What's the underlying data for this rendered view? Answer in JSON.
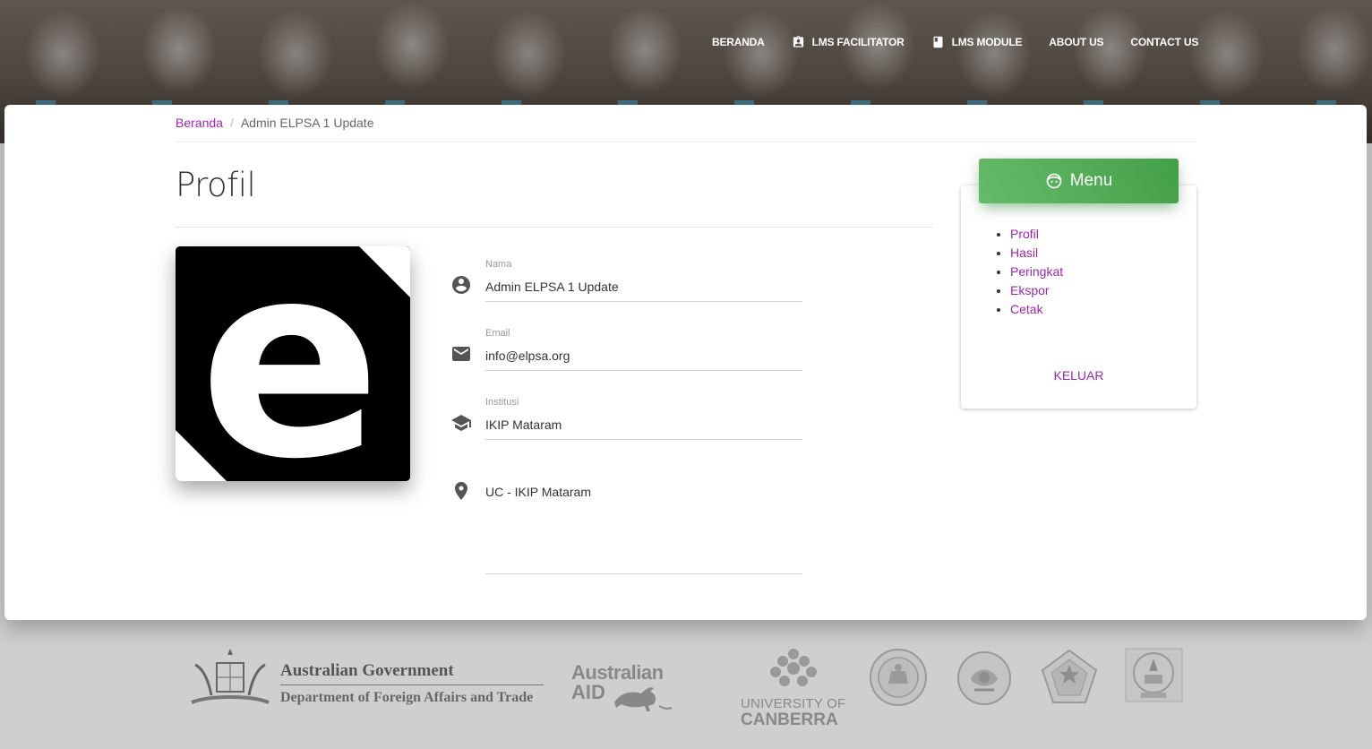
{
  "nav": {
    "items": [
      {
        "label": "BERANDA",
        "icon": ""
      },
      {
        "label": "LMS FACILITATOR",
        "icon": "assignment-ind-icon"
      },
      {
        "label": "LMS MODULE",
        "icon": "book-icon"
      },
      {
        "label": "ABOUT US",
        "icon": ""
      },
      {
        "label": "CONTACT US",
        "icon": ""
      }
    ]
  },
  "breadcrumb": {
    "home": "Beranda",
    "current": "Admin ELPSA 1 Update"
  },
  "page": {
    "title": "Profil"
  },
  "profile": {
    "avatar_letter": "e",
    "fields": [
      {
        "label": "Nama",
        "value": "Admin ELPSA 1 Update",
        "icon": "account-circle-icon"
      },
      {
        "label": "Email",
        "value": "info@elpsa.org",
        "icon": "email-icon"
      },
      {
        "label": "Institusi",
        "value": "IKIP Mataram",
        "icon": "school-icon"
      },
      {
        "label": "",
        "value": "UC - IKIP Mataram",
        "icon": "location-pin-icon"
      }
    ]
  },
  "menu": {
    "title": "Menu",
    "items": [
      "Profil",
      "Hasil",
      "Peringkat",
      "Ekspor",
      "Cetak"
    ],
    "logout": "KELUAR"
  },
  "footer": {
    "logos": {
      "aus_gov_line1": "Australian Government",
      "aus_gov_line2": "Department of Foreign Affairs and Trade",
      "aus_aid_line1": "Australian",
      "aus_aid_line2": "AID",
      "uc_line1": "UNIVERSITY OF",
      "uc_line2": "CANBERRA"
    }
  },
  "colors": {
    "accent": "#9c27b0",
    "menu_green": "#4caf50"
  }
}
